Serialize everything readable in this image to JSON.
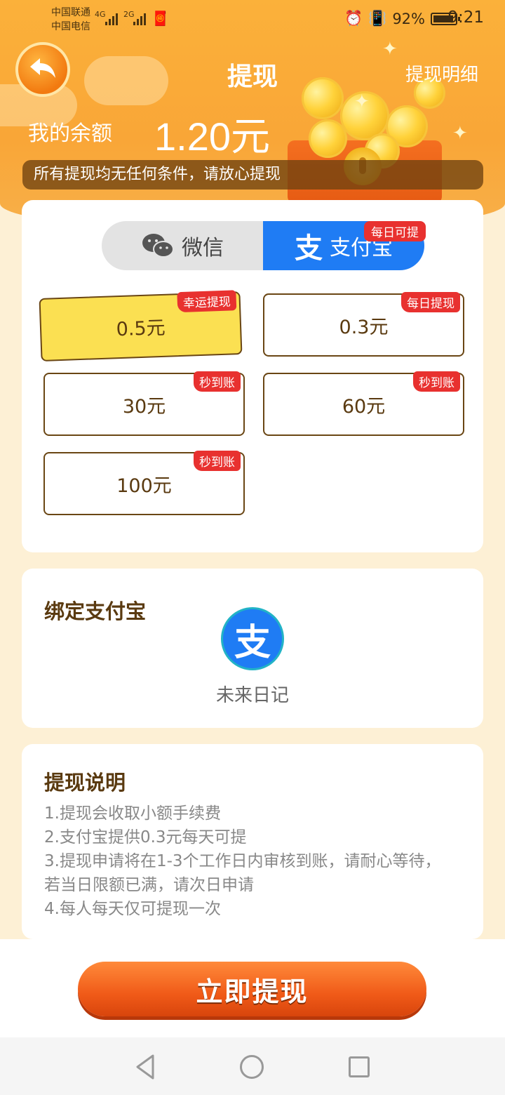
{
  "status_bar": {
    "carrier1": "中国联通",
    "carrier2": "中国电信",
    "net1": "4G",
    "net2": "2G",
    "battery_text": "92%",
    "battery_level": 0.92,
    "time": "9:21"
  },
  "header": {
    "title": "提现",
    "detail_link": "提现明细"
  },
  "balance": {
    "label": "我的余额",
    "value": "1.20元"
  },
  "notice": "所有提现均无任何条件，请放心提现",
  "tabs": {
    "wechat": "微信",
    "alipay": "支付宝",
    "alipay_badge": "每日可提",
    "selected": "alipay"
  },
  "amounts": [
    {
      "label": "0.5元",
      "tag": "幸运提现",
      "selected": true
    },
    {
      "label": "0.3元",
      "tag": "每日提现",
      "selected": false
    },
    {
      "label": "30元",
      "tag": "秒到账",
      "selected": false
    },
    {
      "label": "60元",
      "tag": "秒到账",
      "selected": false
    },
    {
      "label": "100元",
      "tag": "秒到账",
      "selected": false
    }
  ],
  "bind": {
    "title": "绑定支付宝",
    "account_name": "未来日记"
  },
  "instructions": {
    "title": "提现说明",
    "items": [
      "1.提现会收取小额手续费",
      "2.支付宝提供0.3元每天可提",
      "3.提现申请将在1-3个工作日内审核到账，请耐心等待，若当日限额已满，请次日申请",
      "4.每人每天仅可提现一次"
    ]
  },
  "cta": "立即提现",
  "colors": {
    "header_orange": "#f9a637",
    "alipay_blue": "#1f7cf4",
    "tag_red": "#e8312f",
    "selected_yellow": "#fbe052",
    "cta_orange": "#f05a18"
  }
}
